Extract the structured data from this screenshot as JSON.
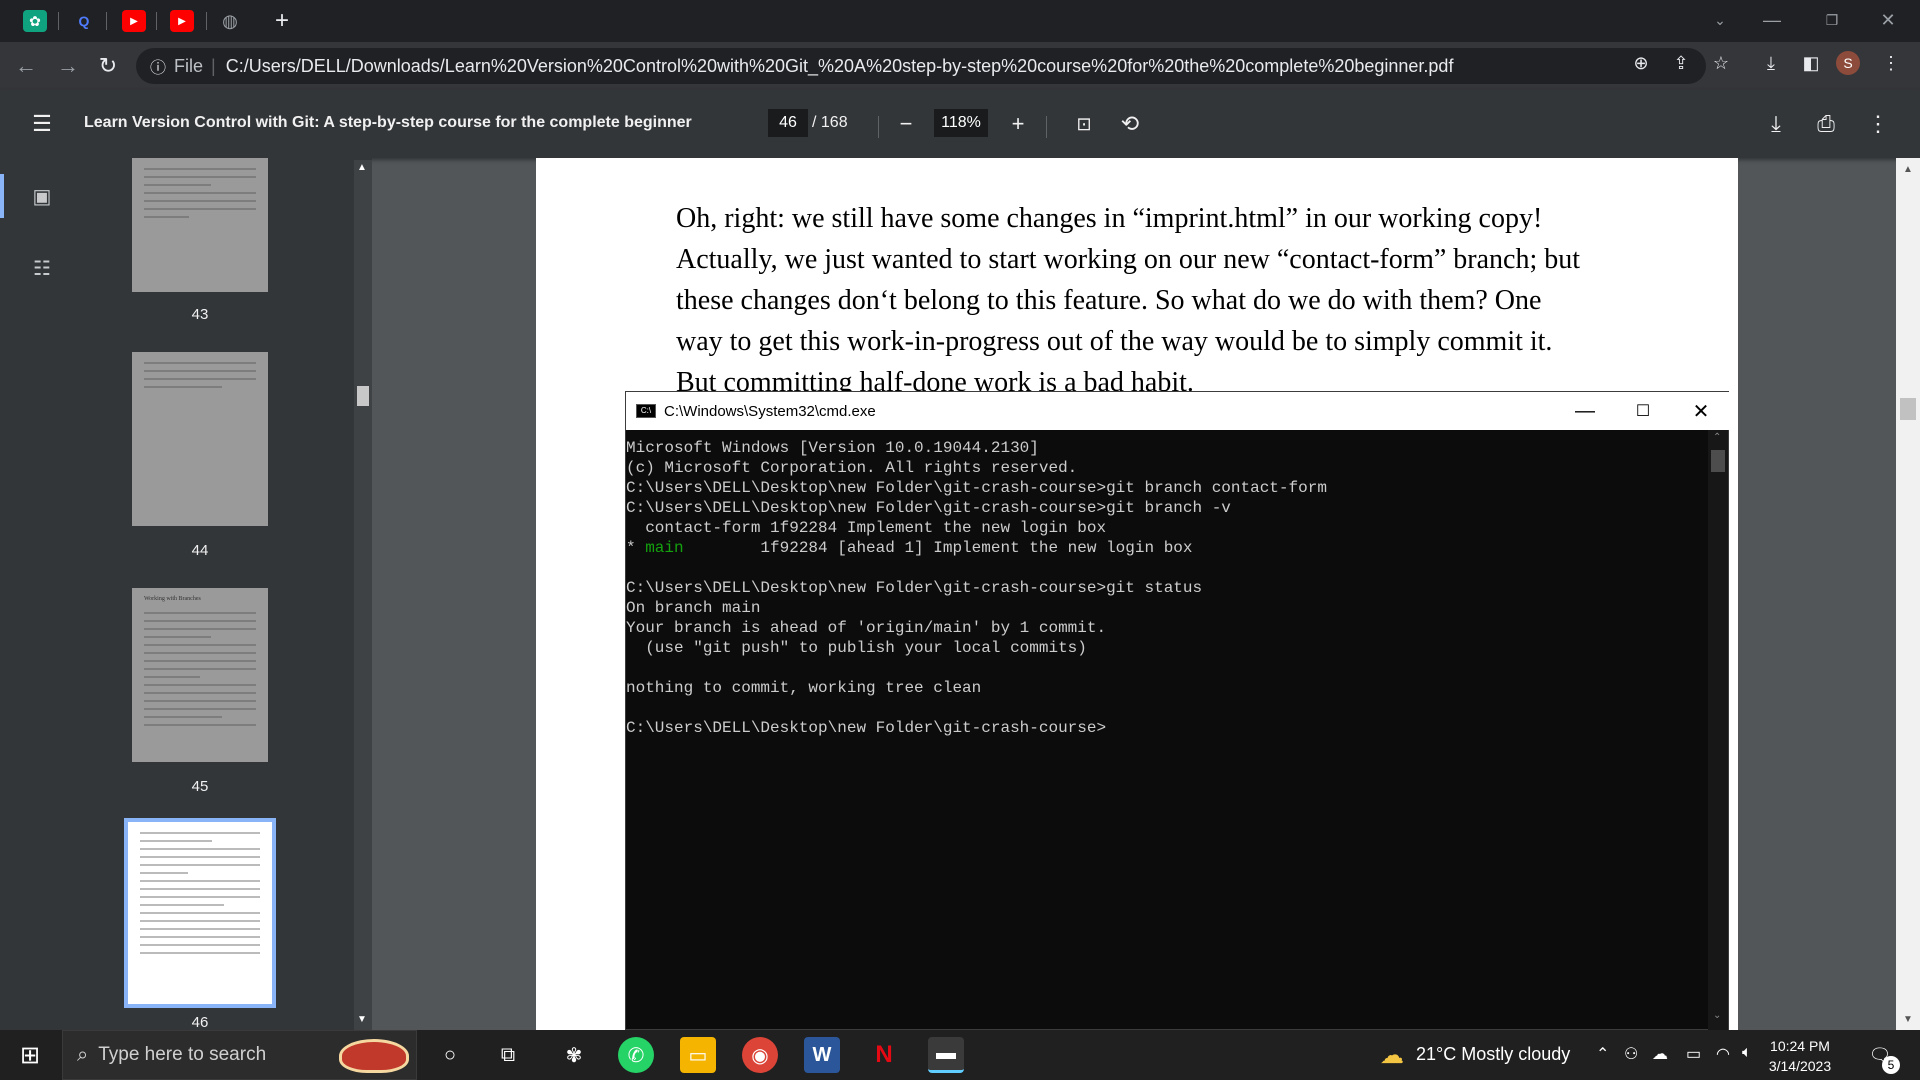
{
  "browser": {
    "tabs": [
      {
        "icon": "chatgpt-icon",
        "color": "#10a37f"
      },
      {
        "icon": "quora-icon",
        "color": "#3b82f6"
      },
      {
        "icon": "youtube-icon",
        "color": "#ff0000"
      },
      {
        "icon": "youtube-icon",
        "color": "#ff0000"
      },
      {
        "icon": "globe-icon",
        "color": "#9aa0a6"
      }
    ],
    "new_tab_label": "+",
    "address": {
      "scheme_label": "File",
      "url": "C:/Users/DELL/Downloads/Learn%20Version%20Control%20with%20Git_%20A%20step-by-step%20course%20for%20the%20complete%20beginner.pdf"
    },
    "profile_initial": "S"
  },
  "pdf_toolbar": {
    "title": "Learn Version Control with Git: A step-by-step course for the complete beginner",
    "current_page": "46",
    "total_pages": "/ 168",
    "zoom": "118%"
  },
  "sidebar": {
    "thumbnails": [
      {
        "label": "43"
      },
      {
        "label": "44"
      },
      {
        "label": "45"
      },
      {
        "label": "46"
      }
    ],
    "thumb45_heading": "Working with Branches"
  },
  "pdf_page": {
    "lines": [
      "Oh, right: we still have some changes in “imprint.html” in our working copy!",
      "Actually, we just wanted to start working on our new “contact-form” branch; but",
      "these changes don‘t belong to this feature. So what do we do with them? One",
      "way to get this work-in-progress out of the way would be to simply commit it.",
      "But committing half-done work is a bad habit."
    ]
  },
  "cmd": {
    "title": "C:\\Windows\\System32\\cmd.exe",
    "lines": [
      "Microsoft Windows [Version 10.0.19044.2130]",
      "(c) Microsoft Corporation. All rights reserved.",
      "",
      "C:\\Users\\DELL\\Desktop\\new Folder\\git-crash-course>git branch contact-form",
      "",
      "C:\\Users\\DELL\\Desktop\\new Folder\\git-crash-course>git branch -v",
      "  contact-form 1f92284 Implement the new login box",
      "",
      "",
      "C:\\Users\\DELL\\Desktop\\new Folder\\git-crash-course>git status",
      "On branch main",
      "Your branch is ahead of 'origin/main' by 1 commit.",
      "  (use \"git push\" to publish your local commits)",
      "",
      "nothing to commit, working tree clean",
      "",
      "C:\\Users\\DELL\\Desktop\\new Folder\\git-crash-course>"
    ],
    "main_branch_marker": "* ",
    "main_branch_name": "main",
    "main_branch_rest": "        1f92284 [ahead 1] Implement the new login box"
  },
  "taskbar": {
    "search_placeholder": "Type here to search",
    "weather": "21°C  Mostly cloudy",
    "time": "10:24 PM",
    "date": "3/14/2023",
    "notification_count": "5"
  }
}
